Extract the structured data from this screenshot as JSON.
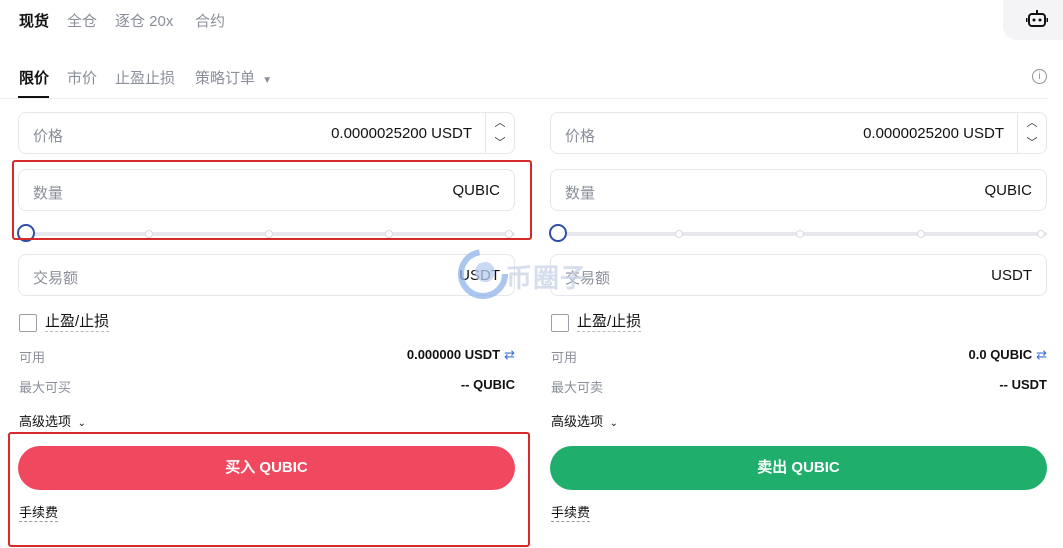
{
  "margin_tabs": [
    {
      "label": "现货",
      "active": true
    },
    {
      "label": "全仓",
      "active": false
    },
    {
      "label": "逐仓 20x",
      "active": false
    },
    {
      "label": "合约",
      "active": false
    }
  ],
  "order_tabs": [
    {
      "label": "限价",
      "active": true
    },
    {
      "label": "市价",
      "active": false
    },
    {
      "label": "止盈止损",
      "active": false
    },
    {
      "label": "策略订单",
      "active": false
    }
  ],
  "icons": {
    "bot": "robot-icon",
    "info": "info-icon",
    "dropdown": "caret-down-icon",
    "swap": "swap-icon",
    "chevron": "chevron-down-icon"
  },
  "watermark_text": "币圈子",
  "buy": {
    "price_label": "价格",
    "price_value": "0.0000025200 USDT",
    "amount_label": "数量",
    "amount_unit": "QUBIC",
    "slider_percent": 0,
    "total_label": "交易额",
    "total_unit": "USDT",
    "tpsl_label": "止盈/止损",
    "available_label": "可用",
    "available_value": "0.000000 USDT",
    "max_label": "最大可买",
    "max_value": "-- QUBIC",
    "advanced_label": "高级选项",
    "button_label": "买入 QUBIC",
    "fee_label": "手续费"
  },
  "sell": {
    "price_label": "价格",
    "price_value": "0.0000025200 USDT",
    "amount_label": "数量",
    "amount_unit": "QUBIC",
    "slider_percent": 0,
    "total_label": "交易额",
    "total_unit": "USDT",
    "tpsl_label": "止盈/止损",
    "available_label": "可用",
    "available_value": "0.0 QUBIC",
    "max_label": "最大可卖",
    "max_value": "-- USDT",
    "advanced_label": "高级选项",
    "button_label": "卖出 QUBIC",
    "fee_label": "手续费"
  },
  "colors": {
    "buy": "#f0485e",
    "sell": "#1fae6c",
    "highlight": "#d52a2a",
    "slider_thumb": "#2d4fa6"
  }
}
